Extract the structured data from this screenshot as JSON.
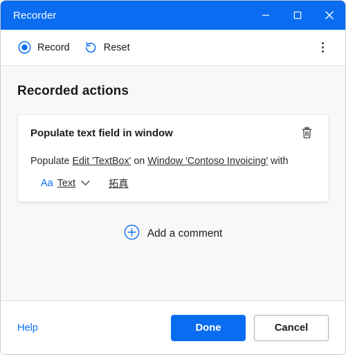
{
  "window": {
    "title": "Recorder",
    "controls": {
      "minimize": "minimize-icon",
      "maximize": "maximize-icon",
      "close": "close-icon"
    },
    "accent_color": "#0a6cf0",
    "titlebar_text_color": "#ffffff"
  },
  "toolbar": {
    "record_label": "Record",
    "record_icon": "record-circle-icon",
    "reset_label": "Reset",
    "reset_icon": "undo-arrow-icon",
    "overflow_icon": "more-vertical-icon"
  },
  "content": {
    "section_title": "Recorded actions"
  },
  "action_card": {
    "title": "Populate text field in window",
    "delete_icon": "trash-icon",
    "detail": {
      "prefix": "Populate",
      "target_link": "Edit 'TextBox'",
      "joiner": "on",
      "window_link": "Window 'Contoso Invoicing'",
      "suffix": "with"
    },
    "value_row": {
      "type_icon": "Aa",
      "type_icon_name": "text-type-icon",
      "type_label": "Text",
      "chevron_icon": "chevron-down-icon",
      "value": "拓真"
    }
  },
  "add_comment": {
    "icon": "plus-circle-icon",
    "label": "Add a comment"
  },
  "footer": {
    "help_label": "Help",
    "primary_label": "Done",
    "secondary_label": "Cancel"
  }
}
